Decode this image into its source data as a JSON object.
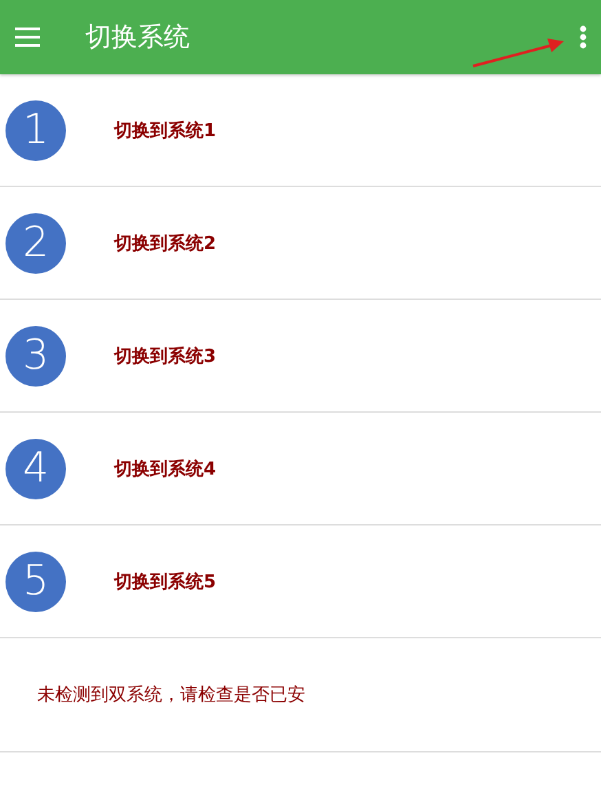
{
  "app_bar": {
    "title": "切换系统"
  },
  "systems": [
    {
      "number": "1",
      "label": "切换到系统1"
    },
    {
      "number": "2",
      "label": "切换到系统2"
    },
    {
      "number": "3",
      "label": "切换到系统3"
    },
    {
      "number": "4",
      "label": "切换到系统4"
    },
    {
      "number": "5",
      "label": "切换到系统5"
    }
  ],
  "notice": "未检测到双系统，请检查是否已安"
}
